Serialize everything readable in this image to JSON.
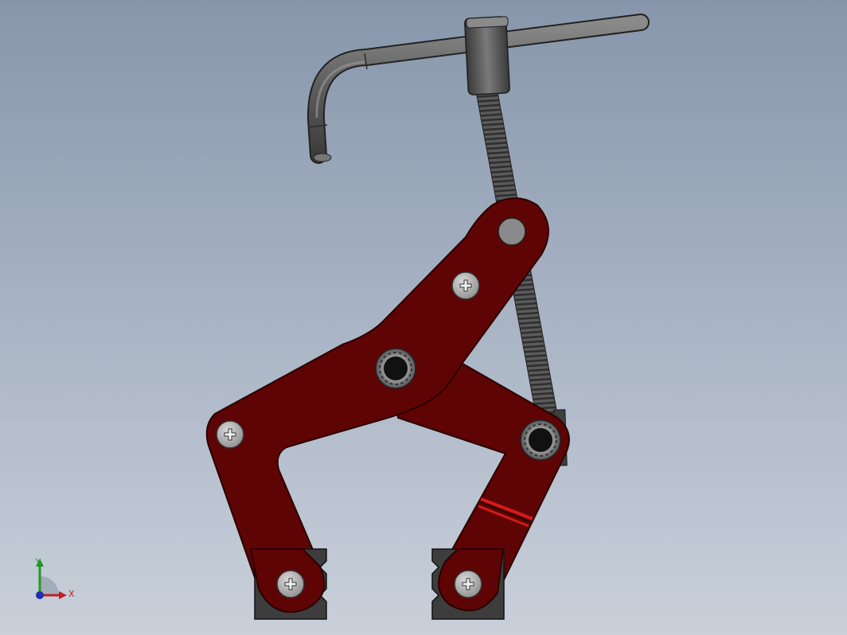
{
  "viewport": {
    "background_top": "#8796ab",
    "background_bottom": "#c9d0da"
  },
  "model": {
    "name": "",
    "colors": {
      "arm_red": "#5e0404",
      "arm_edge": "#2a0000",
      "highlight_red": "#c81818",
      "screw_gray": "#555555",
      "handle_gray": "#5c5c5c",
      "pad_gray": "#3d3d3d",
      "bolt_gray": "#b0b0b0",
      "pin_black": "#111111"
    }
  },
  "triad": {
    "x_label": "X",
    "y_label": "Y",
    "x_color": "#c02020",
    "y_color": "#1e9a1e",
    "z_color": "#2030b0"
  }
}
